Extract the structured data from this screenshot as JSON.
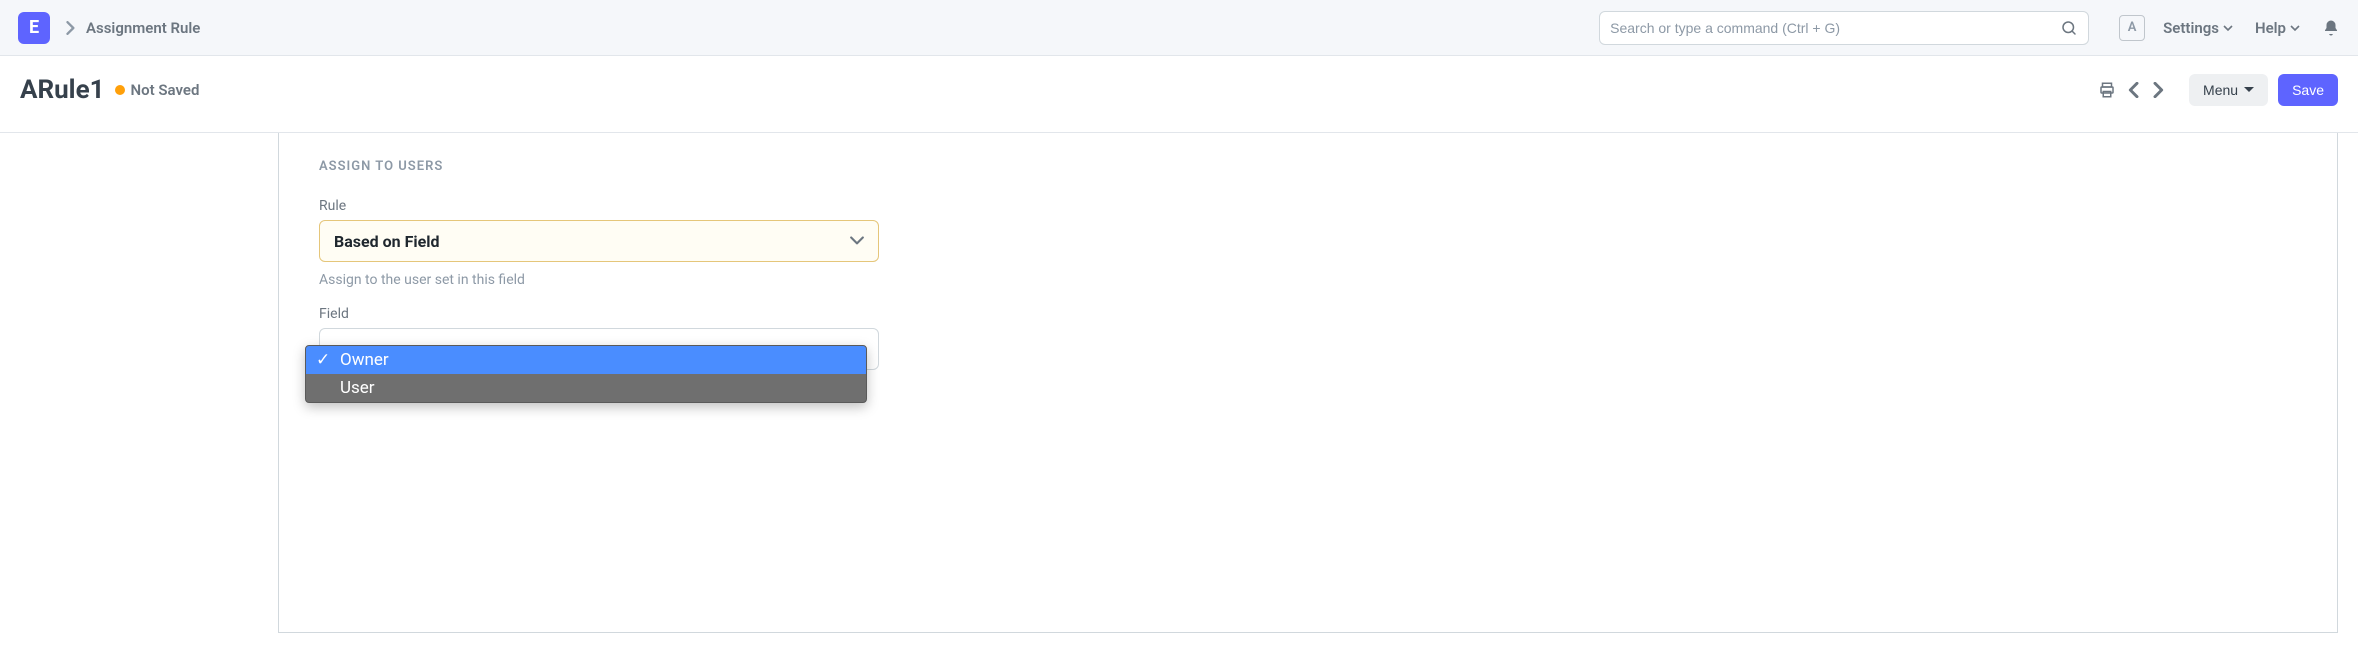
{
  "navbar": {
    "logo_letter": "E",
    "breadcrumb": "Assignment Rule",
    "search_placeholder": "Search or type a command (Ctrl + G)",
    "avatar_letter": "A",
    "settings_label": "Settings",
    "help_label": "Help"
  },
  "header": {
    "title": "ARule1",
    "status": "Not Saved",
    "menu_label": "Menu",
    "save_label": "Save"
  },
  "form": {
    "section_title": "ASSIGN TO USERS",
    "rule": {
      "label": "Rule",
      "value": "Based on Field",
      "help": "Assign to the user set in this field"
    },
    "field": {
      "label": "Field",
      "options": [
        {
          "label": "Owner",
          "selected": true
        },
        {
          "label": "User",
          "selected": false
        }
      ]
    }
  }
}
